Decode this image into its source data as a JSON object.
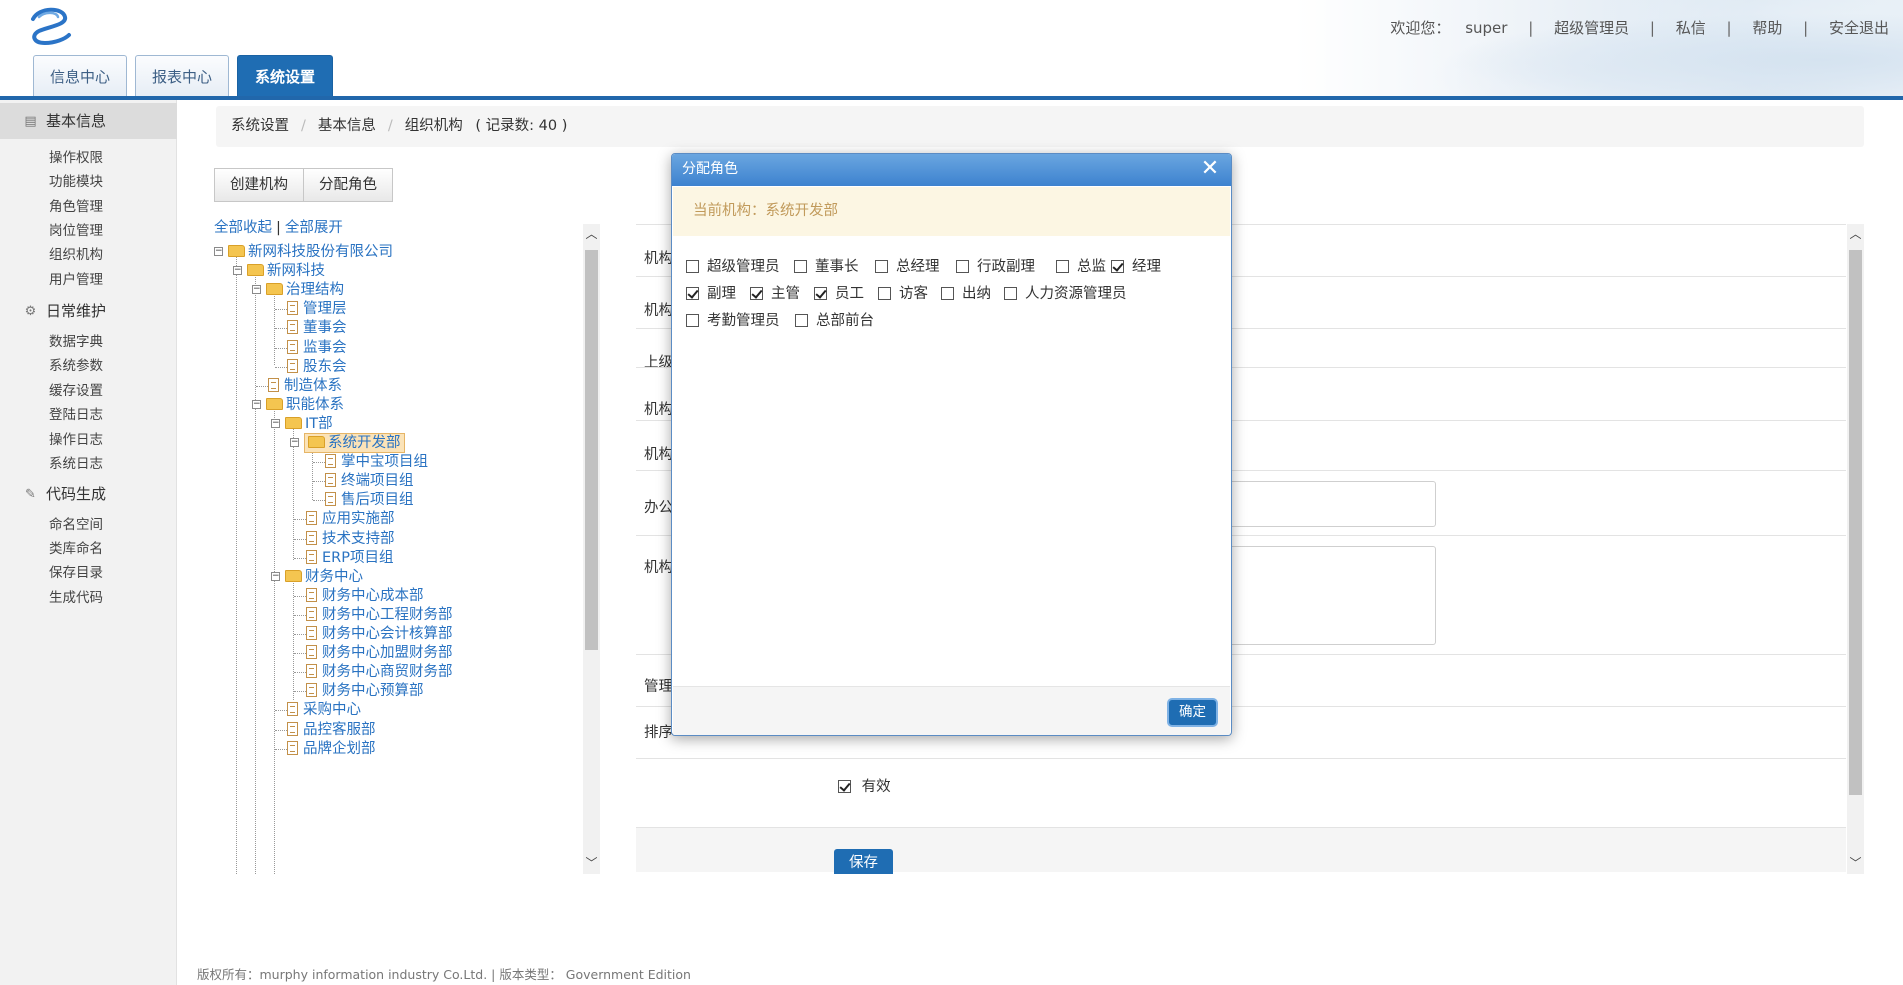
{
  "header": {
    "welcome": "欢迎您：",
    "username": "super",
    "role": "超级管理员",
    "links": [
      "私信",
      "帮助",
      "安全退出"
    ],
    "tabs": [
      "信息中心",
      "报表中心",
      "系统设置"
    ],
    "active_tab": "系统设置"
  },
  "sidebar": {
    "groups": [
      {
        "title": "基本信息",
        "icon": "list-icon",
        "items": [
          "操作权限",
          "功能模块",
          "角色管理",
          "岗位管理",
          "组织机构",
          "用户管理"
        ]
      },
      {
        "title": "日常维护",
        "icon": "gear-icon",
        "items": [
          "数据字典",
          "系统参数",
          "缓存设置",
          "登陆日志",
          "操作日志",
          "系统日志"
        ]
      },
      {
        "title": "代码生成",
        "icon": "pencil-icon",
        "items": [
          "命名空间",
          "类库命名",
          "保存目录",
          "生成代码"
        ]
      }
    ]
  },
  "breadcrumb": {
    "items": [
      "系统设置",
      "基本信息",
      "组织机构"
    ],
    "count": "( 记录数: 40 )"
  },
  "toolbar": {
    "create_label": "创建机构",
    "assign_label": "分配角色"
  },
  "tree_controls": {
    "collapse_all": "全部收起",
    "separator": "|",
    "expand_all": "全部展开"
  },
  "tree": [
    {
      "label": "新网科技股份有限公司",
      "type": "folder",
      "toggle": "⊟"
    },
    {
      "label": "新网科技",
      "type": "folder",
      "toggle": "⊟"
    },
    {
      "label": "治理结构",
      "type": "folder",
      "toggle": "⊟"
    },
    {
      "label": "管理层",
      "type": "doc"
    },
    {
      "label": "董事会",
      "type": "doc"
    },
    {
      "label": "监事会",
      "type": "doc"
    },
    {
      "label": "股东会",
      "type": "doc"
    },
    {
      "label": "制造体系",
      "type": "doc"
    },
    {
      "label": "职能体系",
      "type": "folder",
      "toggle": "⊟"
    },
    {
      "label": "IT部",
      "type": "folder",
      "toggle": "⊟"
    },
    {
      "label": "系统开发部",
      "type": "folder",
      "toggle": "⊟",
      "selected": true
    },
    {
      "label": "掌中宝项目组",
      "type": "doc"
    },
    {
      "label": "终端项目组",
      "type": "doc"
    },
    {
      "label": "售后项目组",
      "type": "doc"
    },
    {
      "label": "应用实施部",
      "type": "doc"
    },
    {
      "label": "技术支持部",
      "type": "doc"
    },
    {
      "label": "ERP项目组",
      "type": "doc"
    },
    {
      "label": "财务中心",
      "type": "folder",
      "toggle": "⊟"
    },
    {
      "label": "财务中心成本部",
      "type": "doc"
    },
    {
      "label": "财务中心工程财务部",
      "type": "doc"
    },
    {
      "label": "财务中心会计核算部",
      "type": "doc"
    },
    {
      "label": "财务中心加盟财务部",
      "type": "doc"
    },
    {
      "label": "财务中心商贸财务部",
      "type": "doc"
    },
    {
      "label": "财务中心预算部",
      "type": "doc"
    },
    {
      "label": "采购中心",
      "type": "doc"
    },
    {
      "label": "品控客服部",
      "type": "doc"
    },
    {
      "label": "品牌企划部",
      "type": "doc"
    }
  ],
  "form": {
    "labels": [
      "机构",
      "机构",
      "上级",
      "机构",
      "机构",
      "办公",
      "机构",
      "管理",
      "排序"
    ],
    "valid_label": "有效",
    "valid_checked": true,
    "save_label": "保存"
  },
  "modal": {
    "title": "分配角色",
    "close_glyph": "✕",
    "notice": "当前机构：系统开发部",
    "roles": [
      {
        "label": "超级管理员",
        "checked": false
      },
      {
        "label": "董事长",
        "checked": false
      },
      {
        "label": "总经理",
        "checked": false
      },
      {
        "label": "行政副理",
        "checked": false
      },
      {
        "label": "总监",
        "checked": false
      },
      {
        "label": "经理",
        "checked": true
      },
      {
        "label": "副理",
        "checked": true
      },
      {
        "label": "主管",
        "checked": true
      },
      {
        "label": "员工",
        "checked": true
      },
      {
        "label": "访客",
        "checked": false
      },
      {
        "label": "出纳",
        "checked": false
      },
      {
        "label": "人力资源管理员",
        "checked": false
      },
      {
        "label": "考勤管理员",
        "checked": false
      },
      {
        "label": "总部前台",
        "checked": false
      }
    ],
    "ok_label": "确定"
  },
  "footer": "版权所有：murphy information industry Co.Ltd. | 版本类型： Government Edition",
  "colors": {
    "accent": "#1f6db3",
    "link": "#2a73c2",
    "notice_bg": "#fcf6e3",
    "notice_text": "#c19a5b"
  }
}
